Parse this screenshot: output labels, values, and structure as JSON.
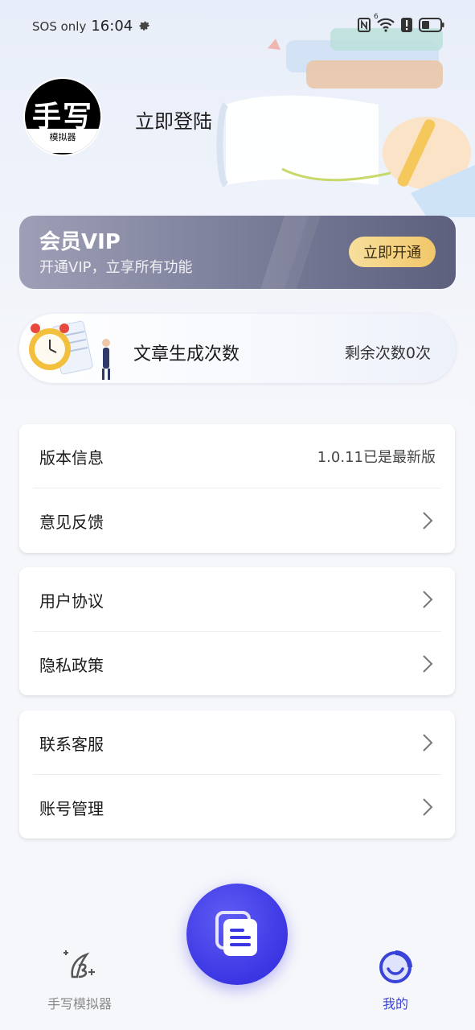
{
  "status_bar": {
    "carrier": "SOS only",
    "time": "16:04",
    "signal_badge": "6"
  },
  "profile": {
    "avatar_text": "手写",
    "avatar_subtext": "模拟器",
    "login_label": "立即登陆"
  },
  "vip": {
    "title": "会员VIP",
    "subtitle": "开通VIP，立享所有功能",
    "button_label": "立即开通"
  },
  "article_count": {
    "title": "文章生成次数",
    "remaining_text": "剩余次数0次"
  },
  "menu_groups": [
    {
      "items": [
        {
          "label": "版本信息",
          "value": "1.0.11已是最新版"
        },
        {
          "label": "意见反馈"
        }
      ]
    },
    {
      "items": [
        {
          "label": "用户协议"
        },
        {
          "label": "隐私政策"
        }
      ]
    },
    {
      "items": [
        {
          "label": "联系客服"
        },
        {
          "label": "账号管理"
        }
      ]
    }
  ],
  "bottom_nav": {
    "left_label": "手写模拟器",
    "right_label": "我的"
  },
  "colors": {
    "accent": "#3b36e3",
    "active_tab": "#3a43d8",
    "vip_button": "#f2c76a"
  },
  "icons": {
    "settings": "gear-icon",
    "nfc": "nfc-icon",
    "wifi": "wifi-icon",
    "alert": "alert-icon",
    "battery": "battery-icon",
    "chevron": "chevron-right-icon",
    "fab": "document-icon",
    "nav_left": "pen-icon",
    "nav_right": "smile-icon"
  }
}
